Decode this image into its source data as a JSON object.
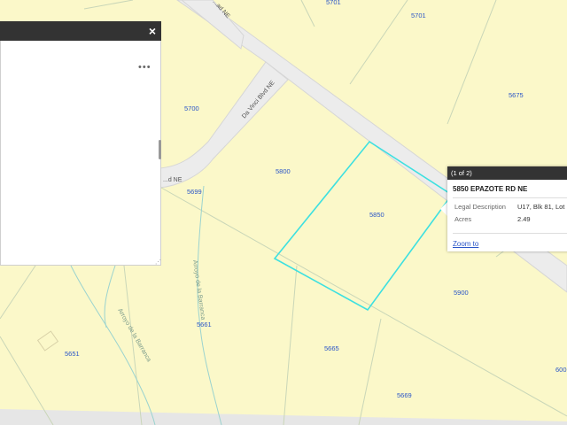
{
  "map": {
    "parcels": [
      "5701",
      "5701",
      "5675",
      "5700",
      "5800",
      "5699",
      "5850",
      "5900",
      "5661",
      "5651",
      "5665",
      "5669",
      "600"
    ],
    "roads": [
      "...ad NE",
      "Da Vinci Blvd NE",
      "...d NE"
    ],
    "arroyos": [
      "Arroyo de la Barranca",
      "Arroyo de la Barranca"
    ],
    "highlight_color": "#3de0e0"
  },
  "panel": {
    "close_icon": "×",
    "menu_icon": "•••",
    "resize_icon": "⋰"
  },
  "popup": {
    "header": "(1 of 2)",
    "title": "5850 EPAZOTE RD NE",
    "rows": [
      {
        "label": "Legal Description",
        "value": "U17, Blk 81, Lot"
      },
      {
        "label": "Acres",
        "value": "2.49"
      }
    ],
    "zoom_label": "Zoom to"
  }
}
